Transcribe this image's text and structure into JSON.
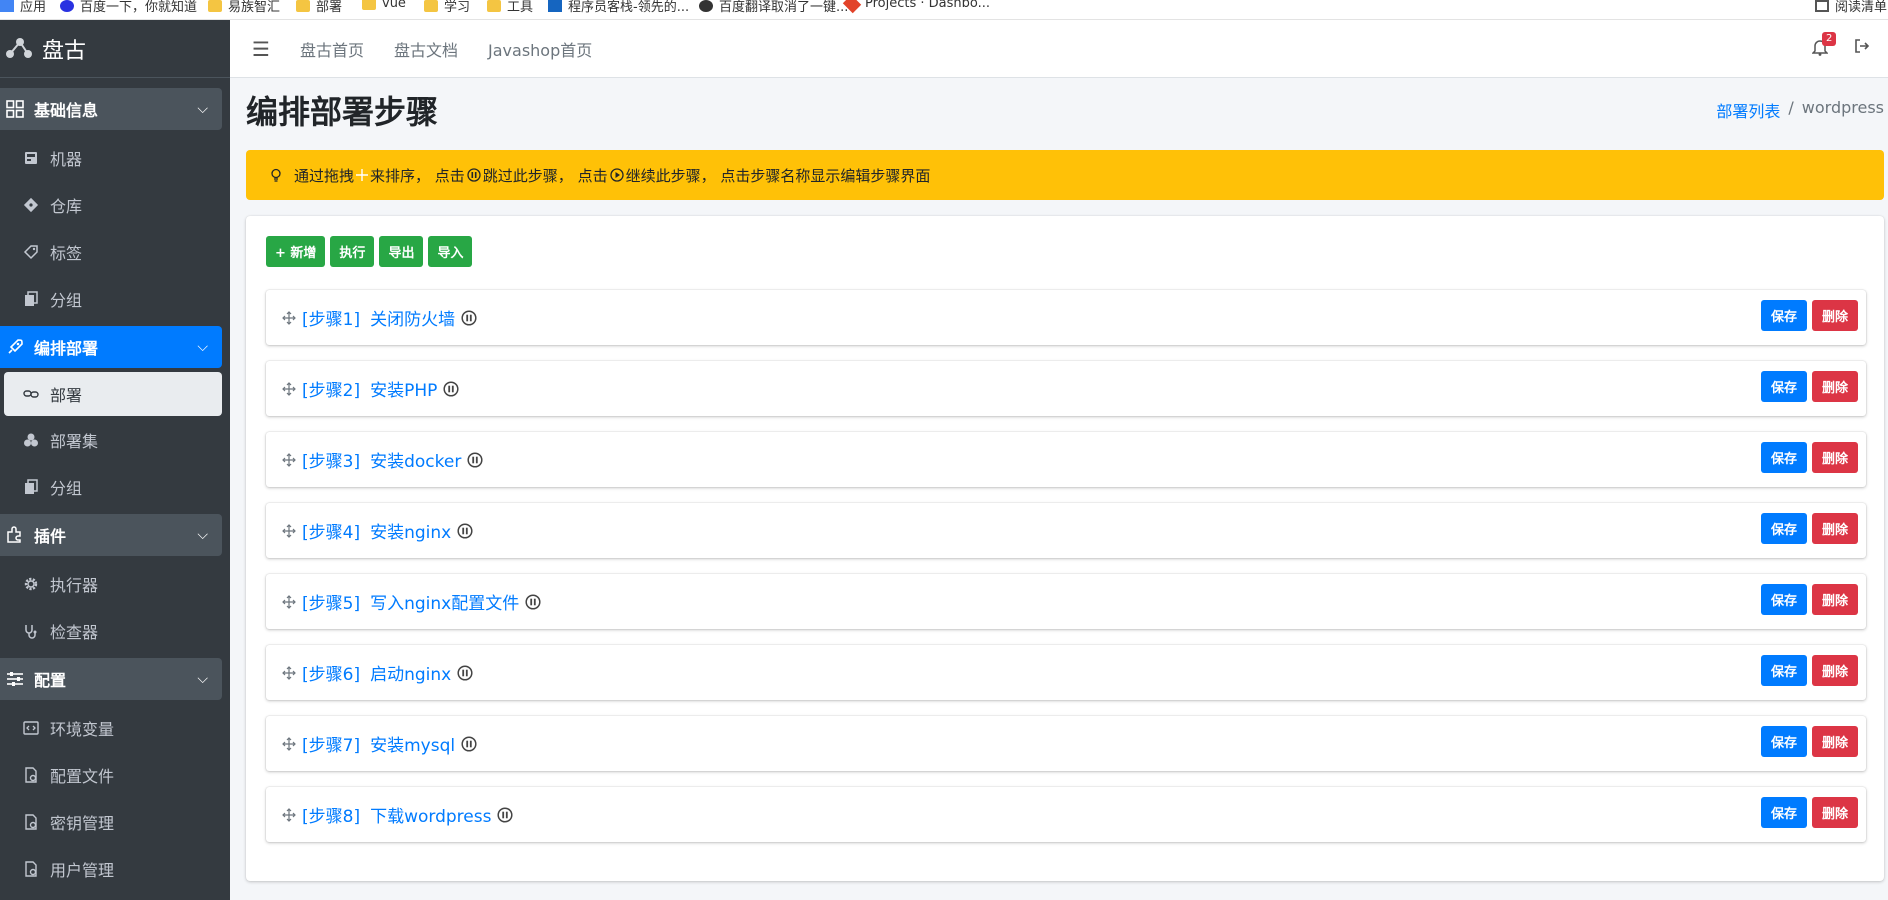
{
  "bookmarks": [
    {
      "label": "应用",
      "icon": "apps-icon"
    },
    {
      "label": "百度一下，你就知道",
      "icon": "baidu-icon"
    },
    {
      "label": "易族智汇",
      "icon": "folder-icon"
    },
    {
      "label": "部署",
      "icon": "folder-icon"
    },
    {
      "label": "vue",
      "icon": "folder-icon"
    },
    {
      "label": "学习",
      "icon": "folder-icon"
    },
    {
      "label": "工具",
      "icon": "folder-icon"
    },
    {
      "label": "程序员客栈-领先的...",
      "icon": "bookmark-icon"
    },
    {
      "label": "百度翻译取消了一键...",
      "icon": "github-icon"
    },
    {
      "label": "Projects · Dashbo...",
      "icon": "gitlab-icon"
    },
    {
      "label": "阅读清单",
      "icon": "reading-list-icon"
    }
  ],
  "brand": {
    "name": "盘古"
  },
  "sidebar": {
    "groups": [
      {
        "label": "基础信息",
        "icon": "grid-icon",
        "items": [
          {
            "label": "机器",
            "icon": "server-icon"
          },
          {
            "label": "仓库",
            "icon": "git-icon"
          },
          {
            "label": "标签",
            "icon": "tag-icon"
          },
          {
            "label": "分组",
            "icon": "copy-icon"
          }
        ]
      },
      {
        "label": "编排部署",
        "icon": "rocket-icon",
        "items": [
          {
            "label": "部署",
            "icon": "link-icon"
          },
          {
            "label": "部署集",
            "icon": "cubes-icon"
          },
          {
            "label": "分组",
            "icon": "copy-icon"
          }
        ]
      },
      {
        "label": "插件",
        "icon": "puzzle-icon",
        "items": [
          {
            "label": "执行器",
            "icon": "cog-icon"
          },
          {
            "label": "检查器",
            "icon": "stethoscope-icon"
          }
        ]
      },
      {
        "label": "配置",
        "icon": "sliders-icon",
        "items": [
          {
            "label": "环境变量",
            "icon": "code-icon"
          },
          {
            "label": "配置文件",
            "icon": "file-cog-icon"
          },
          {
            "label": "密钥管理",
            "icon": "file-cog-icon"
          },
          {
            "label": "用户管理",
            "icon": "file-cog-icon"
          }
        ]
      }
    ]
  },
  "topbar": {
    "links": [
      "盘古首页",
      "盘古文档",
      "Javashop首页"
    ],
    "notification_count": "2"
  },
  "page": {
    "title": "编排部署步骤",
    "breadcrumb": {
      "parent": "部署列表",
      "separator": "/",
      "current": "wordpress"
    }
  },
  "alert": {
    "part1": "通过拖拽",
    "part2": "来排序，  点击",
    "part3": "跳过此步骤，  点击",
    "part4": "继续此步骤，  点击步骤名称显示编辑步骤界面"
  },
  "toolbar": {
    "add": "+ 新增",
    "run": "执行",
    "export": "导出",
    "import": "导入"
  },
  "steps": [
    {
      "num": "[步骤1]",
      "name": "关闭防火墙"
    },
    {
      "num": "[步骤2]",
      "name": "安装PHP"
    },
    {
      "num": "[步骤3]",
      "name": "安装docker"
    },
    {
      "num": "[步骤4]",
      "name": "安装nginx"
    },
    {
      "num": "[步骤5]",
      "name": "写入nginx配置文件"
    },
    {
      "num": "[步骤6]",
      "name": "启动nginx"
    },
    {
      "num": "[步骤7]",
      "name": "安装mysql"
    },
    {
      "num": "[步骤8]",
      "name": "下载wordpress"
    }
  ],
  "step_actions": {
    "save": "保存",
    "delete": "删除"
  },
  "colors": {
    "primary": "#007bff",
    "success": "#28a745",
    "danger": "#dc3545",
    "warning": "#ffc107",
    "sidebar": "#343a40"
  }
}
